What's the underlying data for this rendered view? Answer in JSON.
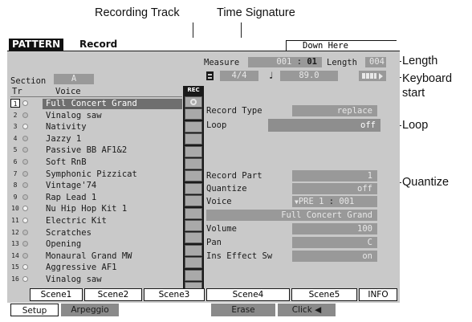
{
  "callouts": {
    "recording_track": "Recording Track",
    "time_signature": "Time Signature",
    "length": "Length",
    "keyboard_start": "Keyboard start",
    "loop": "Loop",
    "quantize": "Quantize"
  },
  "header": {
    "mode": "PATTERN",
    "page": "Record",
    "song_name": "Down Here"
  },
  "section": {
    "label": "Section",
    "value": "A"
  },
  "measure": {
    "label": "Measure",
    "value": "001",
    "beat": "01"
  },
  "length": {
    "label": "Length",
    "value": "004"
  },
  "time_signature": "4/4",
  "tempo": "89.0",
  "keyboard_start_icon": "keyboard-start-icon",
  "track_list": {
    "col_tr": "Tr",
    "col_voice": "Voice",
    "rec_header": "REC TR",
    "tracks": [
      {
        "num": "1",
        "voice": "Full Concert Grand"
      },
      {
        "num": "2",
        "voice": "Vinalog saw"
      },
      {
        "num": "3",
        "voice": "Nativity"
      },
      {
        "num": "4",
        "voice": "Jazzy 1"
      },
      {
        "num": "5",
        "voice": "Passive BB AF1&2"
      },
      {
        "num": "6",
        "voice": "Soft RnB"
      },
      {
        "num": "7",
        "voice": "Symphonic Pizzicat"
      },
      {
        "num": "8",
        "voice": "Vintage'74"
      },
      {
        "num": "9",
        "voice": "Rap Lead 1"
      },
      {
        "num": "10",
        "voice": "Nu Hip Hop Kit 1"
      },
      {
        "num": "11",
        "voice": "Electric Kit"
      },
      {
        "num": "12",
        "voice": "Scratches"
      },
      {
        "num": "13",
        "voice": "Opening"
      },
      {
        "num": "14",
        "voice": "Monaural Grand MW"
      },
      {
        "num": "15",
        "voice": "Aggressive AF1"
      },
      {
        "num": "16",
        "voice": "Vinalog saw"
      }
    ]
  },
  "record_settings": {
    "record_type_label": "Record Type",
    "record_type_value": "replace",
    "loop_label": "Loop",
    "loop_value": "off",
    "record_part_label": "Record Part",
    "record_part_value": "1",
    "quantize_label": "Quantize",
    "quantize_value": "off",
    "voice_label": "Voice",
    "voice_bank": "PRE 1",
    "voice_number": "001",
    "voice_name": "Full Concert Grand",
    "volume_label": "Volume",
    "volume_value": "100",
    "pan_label": "Pan",
    "pan_value": "C",
    "ins_effect_label": "Ins Effect Sw",
    "ins_effect_value": "on"
  },
  "scene_tabs": [
    "Scene1",
    "Scene2",
    "Scene3",
    "Scene4",
    "Scene5",
    "INFO"
  ],
  "bottom_tabs": {
    "setup": "Setup",
    "arpeggio": "Arpeggio",
    "erase": "Erase",
    "click": "Click"
  },
  "colors": {
    "screen_bg": "#c9c9c9",
    "value_box": "#999999",
    "highlight": "#6f6f6f",
    "header_bg": "#111111"
  }
}
